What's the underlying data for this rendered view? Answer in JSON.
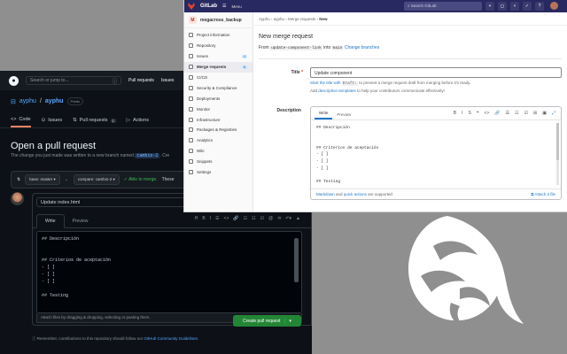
{
  "github": {
    "header": {
      "search_placeholder": "Search or jump to...",
      "slash": "/",
      "nav": [
        "Pull requests",
        "Issues"
      ]
    },
    "repo": {
      "owner": "ayphu",
      "name": "ayphu",
      "visibility": "Public"
    },
    "tabs": [
      {
        "label": "Code"
      },
      {
        "label": "Issues"
      },
      {
        "label": "Pull requests",
        "count": "1"
      },
      {
        "label": "Actions"
      }
    ],
    "page_title": "Open a pull request",
    "description": "The change you just made was written to a new branch named",
    "branch_name": "cambio-2",
    "description_cut": ". Cre",
    "compare": {
      "base": "base: master ▾",
      "compare": "compare: cambio-2 ▾",
      "status": "✓ Able to merge.",
      "status_cut": "These"
    },
    "pr_title": "Update index.html",
    "editor_tabs": {
      "write": "Write",
      "preview": "Preview"
    },
    "toolbar": [
      "H",
      "B",
      "I",
      "☰",
      "<>",
      "🔗",
      "☷",
      "☷",
      "☑",
      "@",
      "⟲",
      "↶▾",
      "▲"
    ],
    "body": "## Descripción\n\n\n## Criterios de aceptación\n- [ ]\n- [ ]\n- [ ]\n\n## Testing",
    "attach_hint": "Attach files by dragging & dropping, selecting or pasting them.",
    "create_button": "Create pull request",
    "remember_text": "Remember, contributions to this repository should follow our",
    "remember_link": "GitHub Community Guidelines."
  },
  "gitlab": {
    "header": {
      "brand": "GitLab",
      "menu": "Menu",
      "search_placeholder": "Search GitLab"
    },
    "project": {
      "initial": "M",
      "name": "megacross_backup"
    },
    "nav": [
      {
        "label": "Project information"
      },
      {
        "label": "Repository"
      },
      {
        "label": "Issues",
        "count": "0"
      },
      {
        "label": "Merge requests",
        "count": "0"
      },
      {
        "label": "CI/CD"
      },
      {
        "label": "Security & Compliance"
      },
      {
        "label": "Deployments"
      },
      {
        "label": "Monitor"
      },
      {
        "label": "Infrastructure"
      },
      {
        "label": "Packages & Registries"
      },
      {
        "label": "Analytics"
      },
      {
        "label": "Wiki"
      },
      {
        "label": "Snippets"
      },
      {
        "label": "Settings"
      }
    ],
    "breadcrumb": [
      "Ayphu",
      "ayphu",
      "Merge requests",
      "New"
    ],
    "page_title": "New merge request",
    "from": {
      "prefix": "From",
      "source": "update-component-link",
      "into": "into",
      "target": "main",
      "change": "Change branches"
    },
    "title_label": "Title",
    "title_value": "Update component",
    "hint": {
      "start": "Start the title with",
      "draft": "Draft:",
      "rest": "to prevent a merge request draft from merging before it's ready.",
      "add": "Add",
      "templates": "description templates",
      "rest2": "to help your contributors communicate effectively!"
    },
    "description_label": "Description",
    "editor_tabs": {
      "write": "Write",
      "preview": "Preview"
    },
    "toolbar": [
      "B",
      "I",
      "S",
      "❝",
      "<>",
      "🔗",
      "☰",
      "☷",
      "☑",
      "⊞",
      "▣",
      "⤢"
    ],
    "body": "## Descripción\n\n\n## Criterios de aceptación\n- [ ]\n- [ ]\n- [ ]\n\n## Testing",
    "footer": {
      "markdown": "Markdown",
      "and": "and",
      "quick": "quick actions",
      "supported": "are supported",
      "attach": "Attach a file"
    }
  }
}
